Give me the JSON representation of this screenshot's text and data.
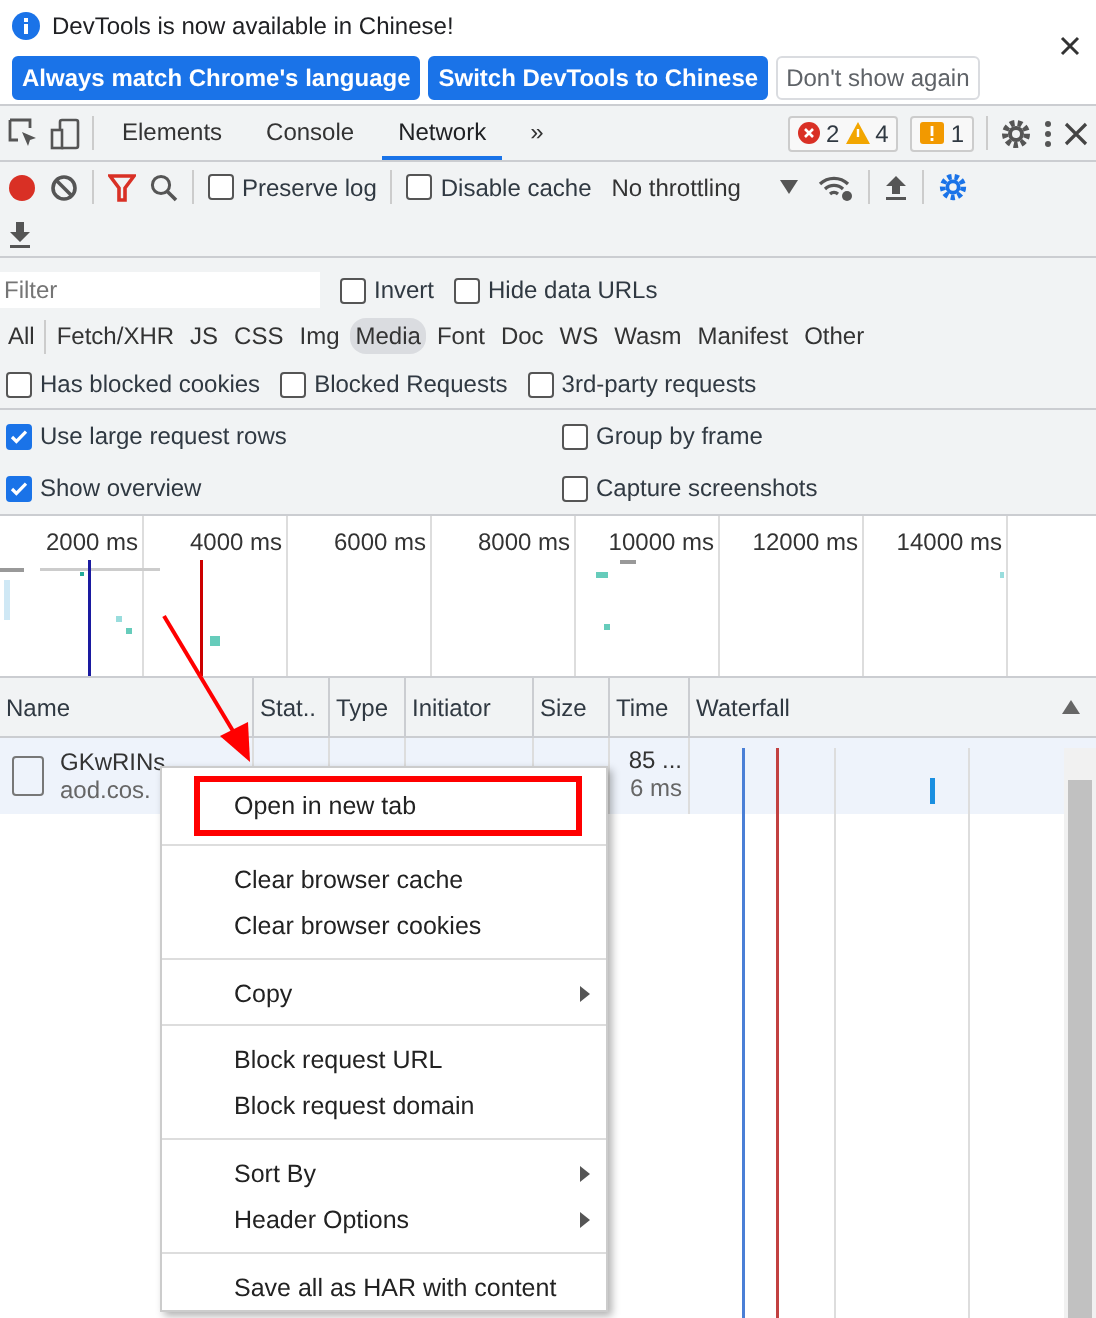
{
  "banner": {
    "message": "DevTools is now available in Chinese!",
    "buttons": [
      {
        "label": "Always match Chrome's language",
        "kind": "primary"
      },
      {
        "label": "Switch DevTools to Chinese",
        "kind": "primary"
      },
      {
        "label": "Don't show again",
        "kind": "secondary"
      }
    ]
  },
  "tabs": [
    {
      "label": "Elements",
      "selected": false
    },
    {
      "label": "Console",
      "selected": false
    },
    {
      "label": "Network",
      "selected": true
    }
  ],
  "more_tabs": "»",
  "counters": {
    "errors": "2",
    "warnings": "4",
    "issues": "1"
  },
  "toolbar": {
    "preserve_log": {
      "label": "Preserve log",
      "checked": false
    },
    "disable_cache": {
      "label": "Disable cache",
      "checked": false
    },
    "throttling": "No throttling"
  },
  "filter": {
    "placeholder": "Filter",
    "invert": {
      "label": "Invert",
      "checked": false
    },
    "hide_data_urls": {
      "label": "Hide data URLs",
      "checked": false
    }
  },
  "types": [
    {
      "label": "All",
      "selected": false
    },
    {
      "label": "Fetch/XHR",
      "selected": false
    },
    {
      "label": "JS",
      "selected": false
    },
    {
      "label": "CSS",
      "selected": false
    },
    {
      "label": "Img",
      "selected": false
    },
    {
      "label": "Media",
      "selected": true
    },
    {
      "label": "Font",
      "selected": false
    },
    {
      "label": "Doc",
      "selected": false
    },
    {
      "label": "WS",
      "selected": false
    },
    {
      "label": "Wasm",
      "selected": false
    },
    {
      "label": "Manifest",
      "selected": false
    },
    {
      "label": "Other",
      "selected": false
    }
  ],
  "request_filters": [
    {
      "label": "Has blocked cookies",
      "checked": false
    },
    {
      "label": "Blocked Requests",
      "checked": false
    },
    {
      "label": "3rd-party requests",
      "checked": false
    }
  ],
  "settings": [
    {
      "label": "Use large request rows",
      "checked": true
    },
    {
      "label": "Group by frame",
      "checked": false
    },
    {
      "label": "Show overview",
      "checked": true
    },
    {
      "label": "Capture screenshots",
      "checked": false
    }
  ],
  "overview": {
    "ticks": [
      "2000 ms",
      "4000 ms",
      "6000 ms",
      "8000 ms",
      "10000 ms",
      "12000 ms",
      "14000 ms"
    ]
  },
  "table": {
    "columns": [
      "Name",
      "Stat..",
      "Type",
      "Initiator",
      "Size",
      "Time",
      "Waterfall"
    ],
    "rows": [
      {
        "name": "GKwRINs",
        "domain": "aod.cos.",
        "time": "85 ...",
        "latency": "6 ms"
      }
    ]
  },
  "context_menu": [
    {
      "label": "Open in new tab",
      "submenu": false,
      "outlined": true,
      "divider_before": false
    },
    {
      "label": "Clear browser cache",
      "submenu": false,
      "outlined": false,
      "divider_before": true
    },
    {
      "label": "Clear browser cookies",
      "submenu": false,
      "outlined": false,
      "divider_before": false
    },
    {
      "label": "Copy",
      "submenu": true,
      "outlined": false,
      "divider_before": true
    },
    {
      "label": "Block request URL",
      "submenu": false,
      "outlined": false,
      "divider_before": true
    },
    {
      "label": "Block request domain",
      "submenu": false,
      "outlined": false,
      "divider_before": false
    },
    {
      "label": "Sort By",
      "submenu": true,
      "outlined": false,
      "divider_before": true
    },
    {
      "label": "Header Options",
      "submenu": true,
      "outlined": false,
      "divider_before": false
    },
    {
      "label": "Save all as HAR with content",
      "submenu": false,
      "outlined": false,
      "divider_before": true
    }
  ]
}
